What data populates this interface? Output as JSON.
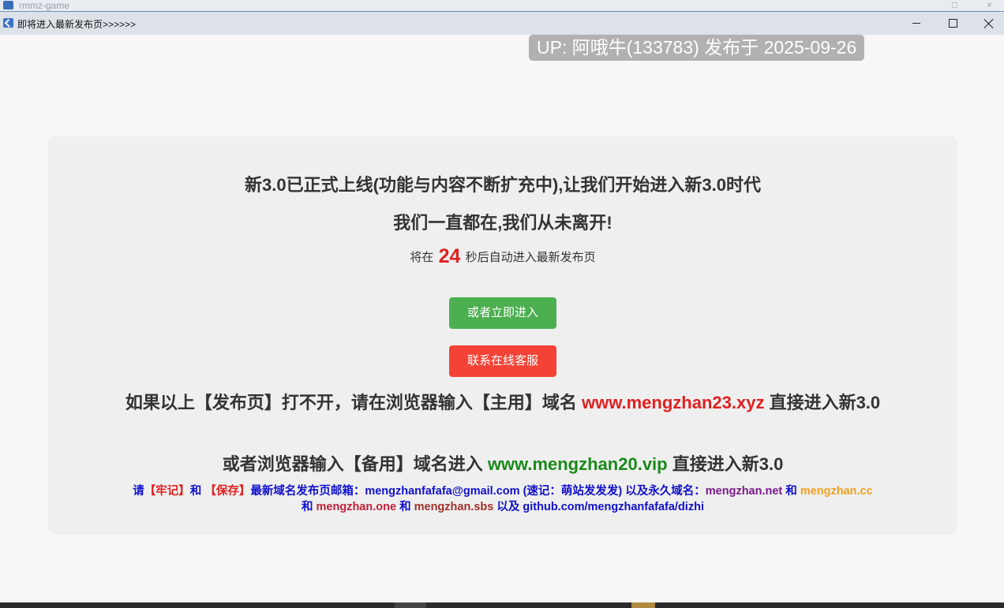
{
  "background_window": {
    "title": "rmmz-game"
  },
  "window": {
    "title": "即将进入最新发布页>>>>>>",
    "controls": {
      "minimize": "minimize",
      "maximize": "maximize",
      "close": "close"
    }
  },
  "watermark": "UP: 阿哦牛(133783) 发布于 2025-09-26",
  "panel": {
    "headline1": "新3.0已正式上线(功能与内容不断扩充中),让我们开始进入新3.0时代",
    "headline2": "我们一直都在,我们从未离开!",
    "countdown": {
      "prefix": "将在",
      "seconds": "24",
      "suffix": "秒后自动进入最新发布页"
    },
    "enter_button": "或者立即进入",
    "service_button": "联系在线客服",
    "primary": {
      "text_before": "如果以上【发布页】打不开，请在浏览器输入【主用】域名 ",
      "domain": "www.mengzhan23.xyz",
      "text_after": " 直接进入新3.0"
    },
    "backup": {
      "text_before": "或者浏览器输入【备用】域名进入 ",
      "domain": "www.mengzhan20.vip",
      "text_after": " 直接进入新3.0"
    },
    "footer": {
      "p1": "请",
      "remember": "【牢记】",
      "p2": "和 ",
      "save": "【保存】",
      "p3": "最新域名发布页邮箱：mengzhanfafafa@gmail.com (速记：萌站发发发) 以及永久域名：",
      "d1": "mengzhan.net",
      "and1": " 和 ",
      "d2": "mengzhan.cc",
      "and2": " 和 ",
      "d3": "mengzhan.one",
      "and3": " 和 ",
      "d4": "mengzhan.sbs",
      "tail": " 以及 github.com/mengzhanfafafa/dizhi"
    }
  }
}
